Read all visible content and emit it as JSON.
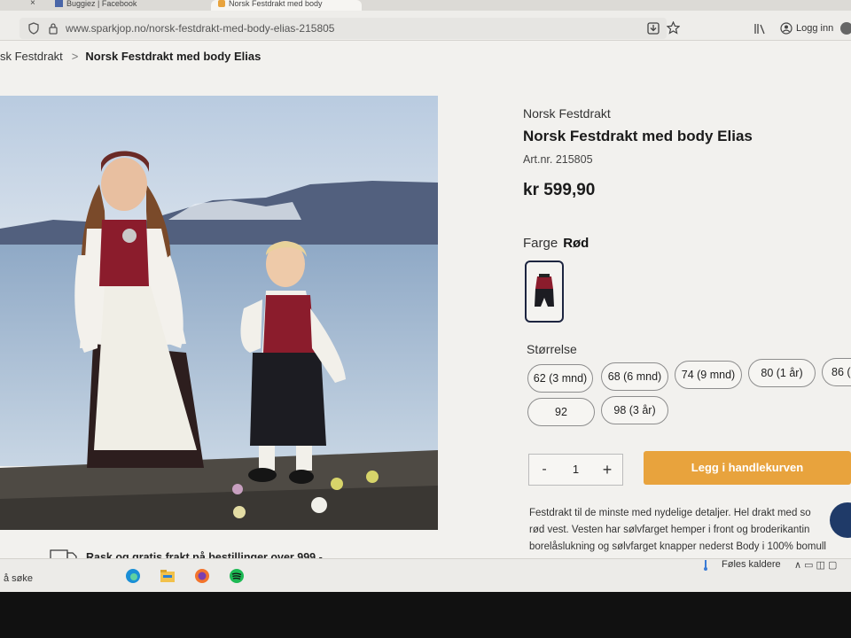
{
  "browser": {
    "tabs": [
      {
        "label": "Buggiez | Facebook"
      },
      {
        "label": "Norsk Festdrakt med body"
      }
    ],
    "tab_close_glyph": "×",
    "url": "www.sparkjop.no/norsk-festdrakt-med-body-elias-215805",
    "login_label": "Logg inn"
  },
  "breadcrumb": {
    "parent": "sk Festdrakt",
    "separator": ">",
    "current": "Norsk Festdrakt med body Elias"
  },
  "product": {
    "category": "Norsk Festdrakt",
    "title": "Norsk Festdrakt med body Elias",
    "art_nr_label": "Art.nr.",
    "art_nr": "215805",
    "price": "kr 599,90",
    "color_label": "Farge",
    "color_value": "Rød",
    "size_label": "Størrelse",
    "sizes": [
      "62 (3 mnd)",
      "68 (6 mnd)",
      "74 (9 mnd)",
      "80 (1 år)",
      "86 (",
      "92",
      "98 (3 år)"
    ],
    "quantity": "1",
    "qty_minus": "-",
    "qty_plus": "+",
    "add_to_cart_label": "Legg i handlekurven",
    "description_lines": [
      "Festdrakt til de minste med nydelige detaljer. Hel drakt med so",
      "rød vest. Vesten har sølvfarget hemper i front og broderikantin",
      "borelåslukning og sølvfarget knapper nederst Body i 100% bomull"
    ]
  },
  "shipping": {
    "text": "Rask og gratis frakt på bestillinger over 999,-"
  },
  "taskbar": {
    "search_label": "å søke",
    "weather_text": "Føles kaldere",
    "apps": [
      "edge-icon",
      "file-explorer-icon",
      "firefox-icon",
      "spotify-icon"
    ]
  },
  "colors": {
    "accent_orange": "#e8a33d",
    "navy": "#1d2540",
    "vest_red": "#8b1c2c"
  }
}
